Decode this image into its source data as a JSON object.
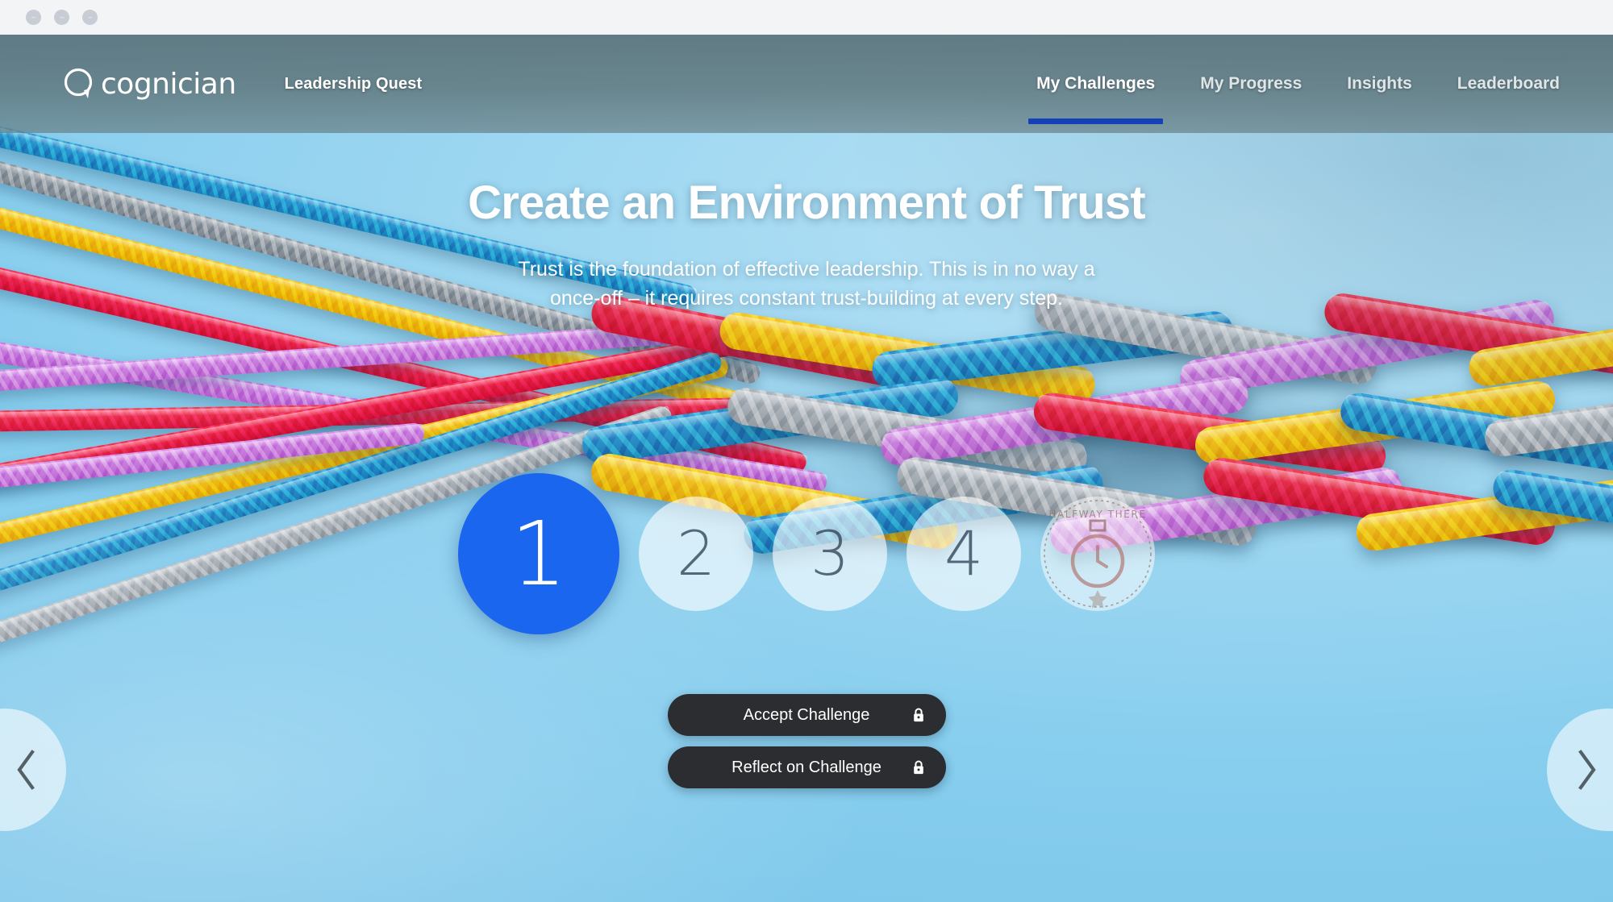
{
  "window": {
    "traffic_lights": [
      "close",
      "minimize",
      "maximize"
    ]
  },
  "header": {
    "logo_icon": "cognician-speech-bubble-logo-icon",
    "logo_word": "cognician",
    "quest_title": "Leadership Quest",
    "nav": [
      {
        "label": "My Challenges",
        "active": true
      },
      {
        "label": "My Progress",
        "active": false
      },
      {
        "label": "Insights",
        "active": false
      },
      {
        "label": "Leaderboard",
        "active": false
      }
    ],
    "active_underline_color": "#1441b8",
    "overlay_color": "#60787e"
  },
  "hero": {
    "title": "Create an Environment of Trust",
    "subtitle": "Trust is the foundation of effective leadership. This is in no way a once-off – it requires constant trust-building at every step.",
    "subtitle_line1": "Trust is the foundation of effective leadership. This is in no way a",
    "subtitle_line2": "once-off – it requires constant trust-building at every step."
  },
  "steps": {
    "active_color": "#1a66ee",
    "locked_number_color": "#2e4456",
    "items": [
      {
        "label": "1",
        "state": "active",
        "size": "lg",
        "type": "number"
      },
      {
        "label": "2",
        "state": "locked",
        "size": "md",
        "type": "number"
      },
      {
        "label": "3",
        "state": "locked",
        "size": "md",
        "type": "number"
      },
      {
        "label": "4",
        "state": "locked",
        "size": "md",
        "type": "number"
      },
      {
        "label": "HALFWAY THERE",
        "state": "badge",
        "size": "md",
        "type": "badge",
        "icon": "halfway-there-medal-icon"
      }
    ]
  },
  "actions": {
    "background_color": "#2b2d31",
    "buttons": [
      {
        "label": "Accept Challenge",
        "locked": true,
        "icon": "lock-icon"
      },
      {
        "label": "Reflect on Challenge",
        "locked": true,
        "icon": "lock-icon"
      }
    ]
  },
  "carousel": {
    "prev_icon": "chevron-left-icon",
    "next_icon": "chevron-right-icon"
  },
  "background": {
    "description": "Braided multicolour ropes on a light blue surface",
    "base_color": "#9ed7f1",
    "rope_colors": [
      "#2e9bd6",
      "#9aa3ab",
      "#f5c417",
      "#e8254b",
      "#c471d6"
    ]
  }
}
